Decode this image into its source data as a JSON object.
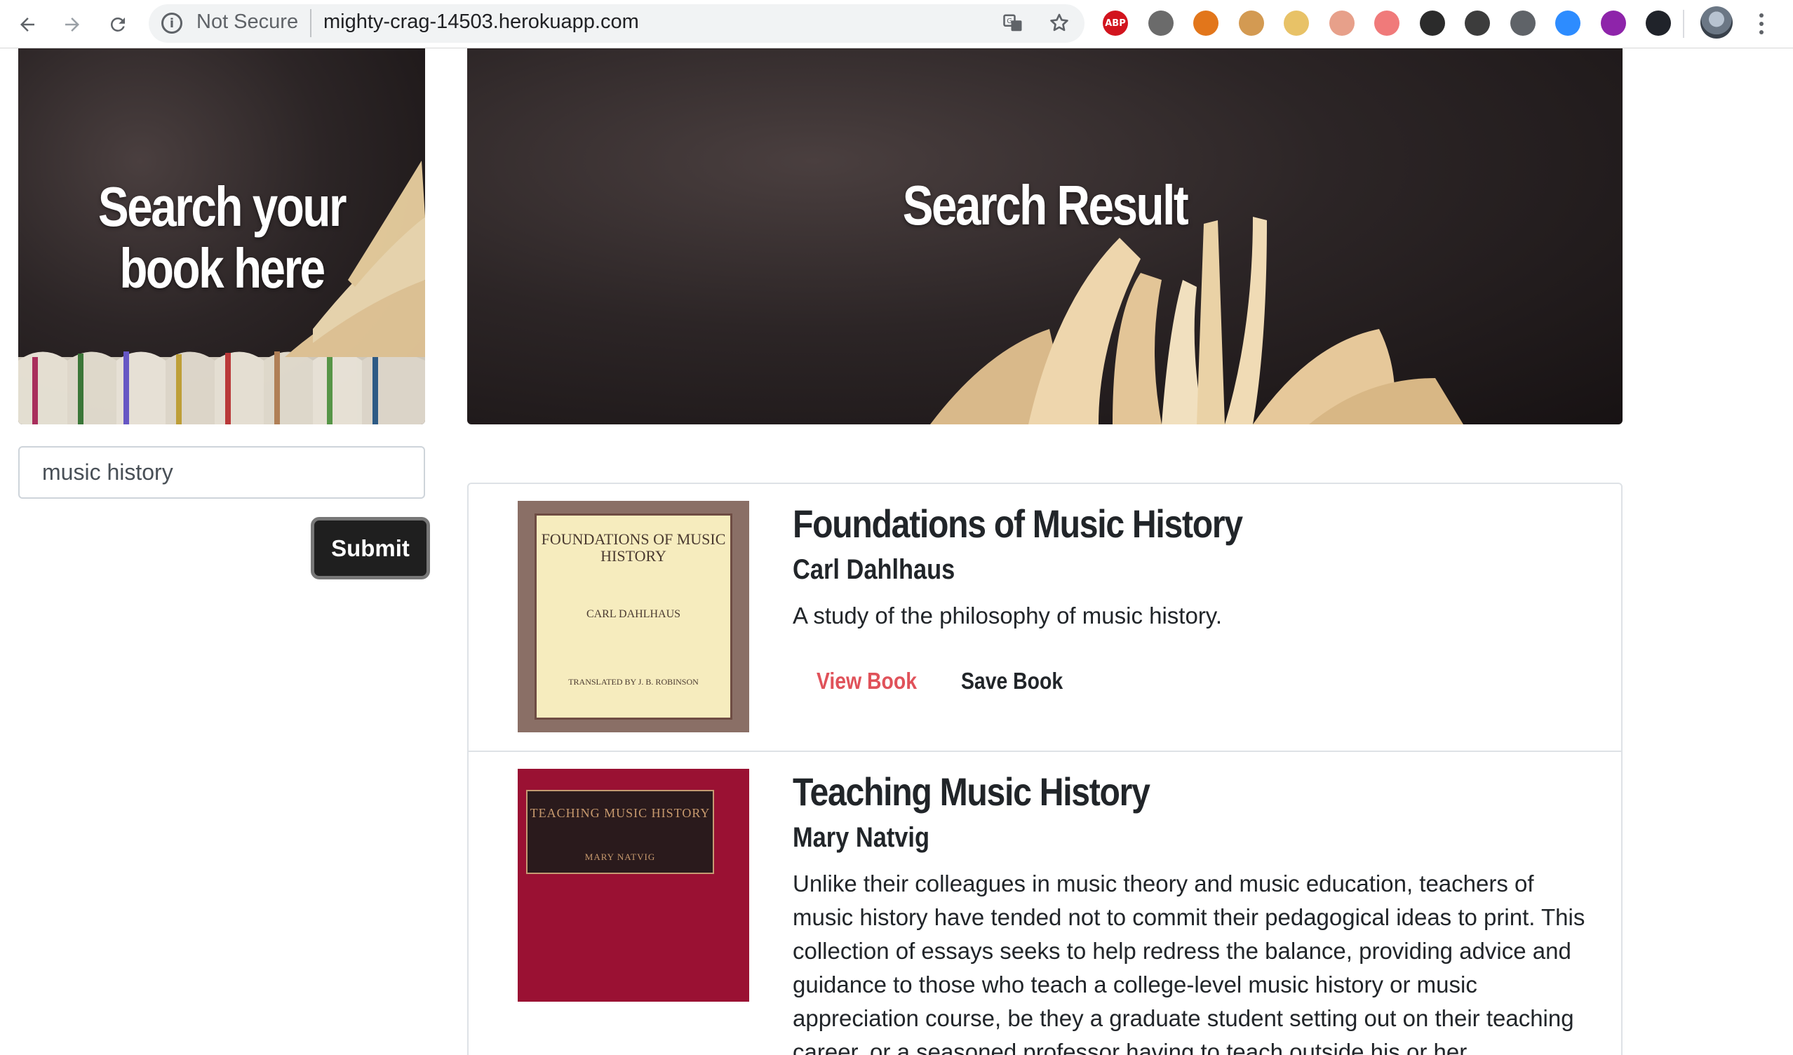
{
  "browser": {
    "security_label": "Not Secure",
    "url": "mighty-crag-14503.herokuapp.com",
    "extensions": [
      {
        "name": "adblock-plus-icon",
        "label": "ABP",
        "color": "#d2141e"
      },
      {
        "name": "circle-extension-icon",
        "label": "",
        "color": "#6b6b6b"
      },
      {
        "name": "metamask-icon",
        "label": "",
        "color": "#e2761b"
      },
      {
        "name": "cookie-icon",
        "label": "",
        "color": "#d39a52"
      },
      {
        "name": "lightbulb-icon",
        "label": "",
        "color": "#e8c267"
      },
      {
        "name": "brain-icon",
        "label": "",
        "color": "#e7a08a"
      },
      {
        "name": "record-icon",
        "label": "",
        "color": "#f07a7a"
      },
      {
        "name": "eyedropper-icon",
        "label": "",
        "color": "#2b2b2b"
      },
      {
        "name": "screenshot-icon",
        "label": "",
        "color": "#3c3c3c"
      },
      {
        "name": "code-icon",
        "label": "",
        "color": "#5f6368"
      },
      {
        "name": "zoom-icon",
        "label": "",
        "color": "#2d8cff"
      },
      {
        "name": "purple-extension-icon",
        "label": "",
        "color": "#8e24aa"
      },
      {
        "name": "react-devtools-icon",
        "label": "",
        "color": "#20232a"
      }
    ]
  },
  "search_panel": {
    "title_line1": "Search your",
    "title_line2": "book here",
    "query": "music history",
    "submit_label": "Submit"
  },
  "results_panel": {
    "title": "Search Result"
  },
  "results": [
    {
      "title": "Foundations of Music History",
      "author": "Carl Dahlhaus",
      "description": "A study of the philosophy of music history.",
      "view_label": "View Book",
      "save_label": "Save Book",
      "cover": {
        "title": "FOUNDATIONS OF MUSIC HISTORY",
        "author": "CARL DAHLHAUS",
        "translator": "TRANSLATED BY J. B. ROBINSON"
      }
    },
    {
      "title": "Teaching Music History",
      "author": "Mary Natvig",
      "description": "Unlike their colleagues in music theory and music education, teachers of music history have tended not to commit their pedagogical ideas to print. This collection of essays seeks to help redress the balance, providing advice and guidance to those who teach a college-level music history or music appreciation course, be they a graduate student setting out on their teaching career, or a seasoned professor having to teach outside his or her",
      "cover": {
        "title": "TEACHING MUSIC HISTORY",
        "author": "MARY NATVIG"
      }
    }
  ],
  "colors": {
    "view_link": "#e0525a",
    "save_link": "#212529",
    "hero_bg": "#2a2324",
    "submit_bg": "#1f1f1f"
  }
}
